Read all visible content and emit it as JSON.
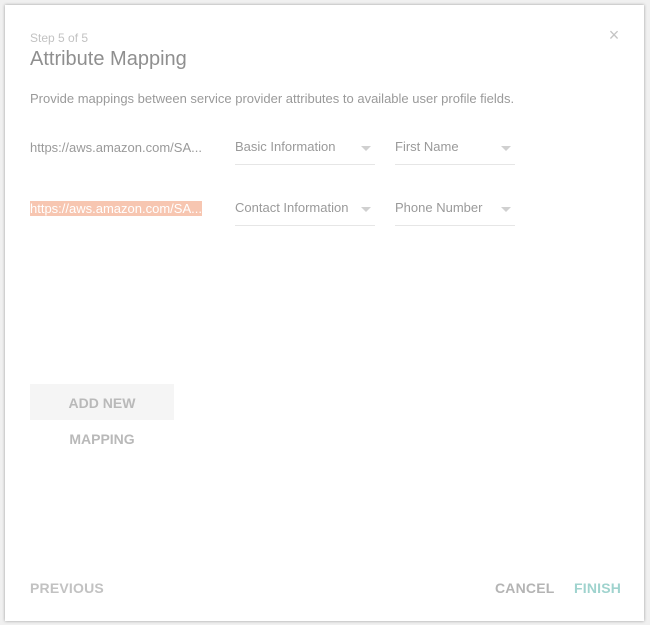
{
  "dialog": {
    "step": "Step 5 of 5",
    "title": "Attribute Mapping",
    "description": "Provide mappings between service provider attributes to available user profile fields.",
    "close_glyph": "×",
    "close_icon": "close-icon"
  },
  "mappings": [
    {
      "sp_attribute": "https://aws.amazon.com/SA...",
      "category": "Basic Information",
      "field": "First Name",
      "highlighted": false
    },
    {
      "sp_attribute": "https://aws.amazon.com/SA...",
      "category": "Contact Information",
      "field": "Phone Number",
      "highlighted": true
    }
  ],
  "actions": {
    "add_mapping": "ADD NEW MAPPING",
    "previous": "PREVIOUS",
    "cancel": "CANCEL",
    "finish": "FINISH"
  },
  "colors": {
    "accent": "#9fd3ce",
    "highlight": "#f7c6b1"
  }
}
